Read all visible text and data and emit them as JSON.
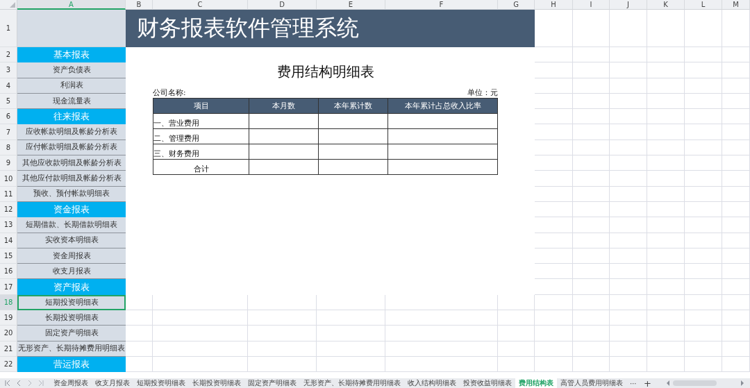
{
  "columns": [
    {
      "letter": "A",
      "selected": true
    },
    {
      "letter": "B",
      "selected": false
    },
    {
      "letter": "C",
      "selected": false
    },
    {
      "letter": "D",
      "selected": false
    },
    {
      "letter": "E",
      "selected": false
    },
    {
      "letter": "F",
      "selected": false
    },
    {
      "letter": "G",
      "selected": false
    },
    {
      "letter": "H",
      "selected": false
    },
    {
      "letter": "I",
      "selected": false
    },
    {
      "letter": "J",
      "selected": false
    },
    {
      "letter": "K",
      "selected": false
    },
    {
      "letter": "L",
      "selected": false
    },
    {
      "letter": "M",
      "selected": false
    }
  ],
  "rows": [
    {
      "number": "1",
      "selected": false
    },
    {
      "number": "2",
      "selected": false
    },
    {
      "number": "3",
      "selected": false
    },
    {
      "number": "4",
      "selected": false
    },
    {
      "number": "5",
      "selected": false
    },
    {
      "number": "6",
      "selected": false
    },
    {
      "number": "7",
      "selected": false
    },
    {
      "number": "8",
      "selected": false
    },
    {
      "number": "9",
      "selected": false
    },
    {
      "number": "10",
      "selected": false
    },
    {
      "number": "11",
      "selected": false
    },
    {
      "number": "12",
      "selected": false
    },
    {
      "number": "13",
      "selected": false
    },
    {
      "number": "14",
      "selected": false
    },
    {
      "number": "15",
      "selected": false
    },
    {
      "number": "16",
      "selected": false
    },
    {
      "number": "17",
      "selected": false
    },
    {
      "number": "18",
      "selected": true
    },
    {
      "number": "19",
      "selected": false
    },
    {
      "number": "20",
      "selected": false
    },
    {
      "number": "21",
      "selected": false
    },
    {
      "number": "22",
      "selected": false
    }
  ],
  "banner": {
    "title": "财务报表软件管理系统"
  },
  "sidebar": {
    "items": [
      {
        "kind": "section",
        "label": "基本报表",
        "selected": false
      },
      {
        "kind": "link",
        "label": "资产负债表",
        "selected": false
      },
      {
        "kind": "link",
        "label": "利润表",
        "selected": false
      },
      {
        "kind": "link",
        "label": "现金流量表",
        "selected": false
      },
      {
        "kind": "section",
        "label": "往来报表",
        "selected": false
      },
      {
        "kind": "link",
        "label": "应收帐款明细及帐龄分析表",
        "selected": false
      },
      {
        "kind": "link",
        "label": "应付帐款明细及帐龄分析表",
        "selected": false
      },
      {
        "kind": "link",
        "label": "其他应收款明细及帐龄分析表",
        "selected": false
      },
      {
        "kind": "link",
        "label": "其他应付款明细及帐龄分析表",
        "selected": false
      },
      {
        "kind": "link",
        "label": "预收、预付帐款明细表",
        "selected": false
      },
      {
        "kind": "section",
        "label": "资金报表",
        "selected": false
      },
      {
        "kind": "link",
        "label": "短期借款、长期借款明细表",
        "selected": false
      },
      {
        "kind": "link",
        "label": "实收资本明细表",
        "selected": false
      },
      {
        "kind": "link",
        "label": "资金周报表",
        "selected": false
      },
      {
        "kind": "link",
        "label": "收支月报表",
        "selected": false
      },
      {
        "kind": "section",
        "label": "资产报表",
        "selected": false
      },
      {
        "kind": "link",
        "label": "短期投资明细表",
        "selected": true
      },
      {
        "kind": "link",
        "label": "长期投资明细表",
        "selected": false
      },
      {
        "kind": "link",
        "label": "固定资产明细表",
        "selected": false
      },
      {
        "kind": "link",
        "label": "无形资产、长期待摊费用明细表",
        "selected": false
      },
      {
        "kind": "section",
        "label": "营运报表",
        "selected": false
      }
    ]
  },
  "report": {
    "title": "费用结构明细表",
    "company_label": "公司名称:",
    "unit_label": "单位：元",
    "columns": [
      "项目",
      "本月数",
      "本年累计数",
      "本年累计占总收入比率"
    ],
    "rows": [
      {
        "item": "一、营业费用",
        "kind": "line"
      },
      {
        "item": "二、管理费用",
        "kind": "line"
      },
      {
        "item": "三、财务费用",
        "kind": "line"
      },
      {
        "item": "合计",
        "kind": "total"
      }
    ]
  },
  "sheet_tabs": [
    {
      "label": "资金周报表",
      "selected": false
    },
    {
      "label": "收支月报表",
      "selected": false
    },
    {
      "label": "短期投资明细表",
      "selected": false
    },
    {
      "label": "长期投资明细表",
      "selected": false
    },
    {
      "label": "固定资产明细表",
      "selected": false
    },
    {
      "label": "无形资产、长期待摊费用明细表",
      "selected": false
    },
    {
      "label": "收入结构明细表",
      "selected": false
    },
    {
      "label": "投资收益明细表",
      "selected": false
    },
    {
      "label": "费用结构表",
      "selected": true
    },
    {
      "label": "高管人员费用明细表",
      "selected": false
    }
  ],
  "tab_more": "⋯",
  "tab_add": "+"
}
